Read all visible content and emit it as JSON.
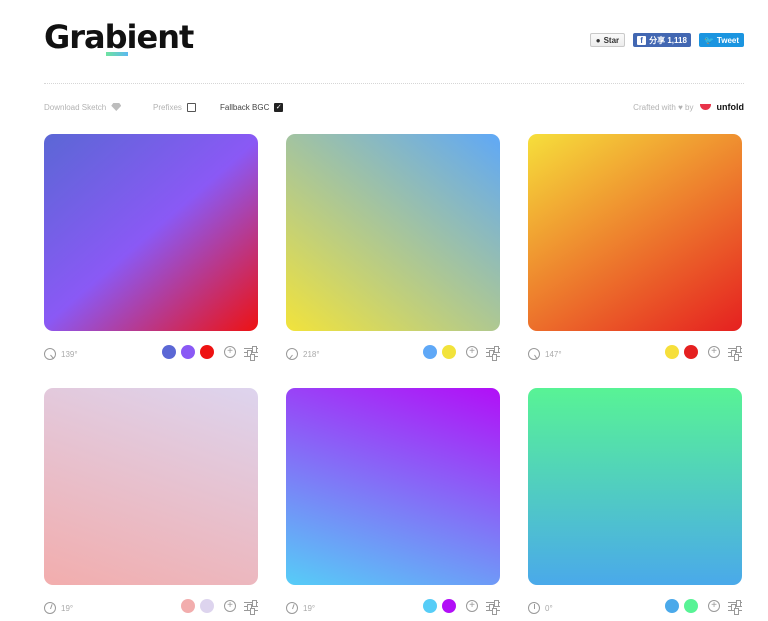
{
  "header": {
    "logo_text": "Grabient",
    "social": {
      "star_label": "Star",
      "fb_label": "分享 1,118",
      "tweet_label": "Tweet"
    }
  },
  "toolbar": {
    "download_sketch": "Download Sketch",
    "prefixes": "Prefixes",
    "prefixes_checked": false,
    "fallback_bgc": "Fallback BGC",
    "fallback_bgc_checked": true,
    "crafted_by": "Crafted with ♥ by",
    "brand": "unfold"
  },
  "gradients": [
    {
      "angle_label": "139°",
      "angle": 139,
      "stops": [
        "#5b67d5",
        "#8a59f5",
        "#ee1212"
      ]
    },
    {
      "angle_label": "218°",
      "angle": 218,
      "stops": [
        "#5fa8f7",
        "#f2e33b"
      ]
    },
    {
      "angle_label": "147°",
      "angle": 147,
      "stops": [
        "#f6df3b",
        "#e52020"
      ]
    },
    {
      "angle_label": "19°",
      "angle": 19,
      "stops": [
        "#f2adad",
        "#ddd4ee"
      ]
    },
    {
      "angle_label": "19°",
      "angle": 19,
      "stops": [
        "#56cdf7",
        "#b20ff7"
      ]
    },
    {
      "angle_label": "0°",
      "angle": 0,
      "stops": [
        "#4aa9ea",
        "#58f395"
      ]
    }
  ]
}
